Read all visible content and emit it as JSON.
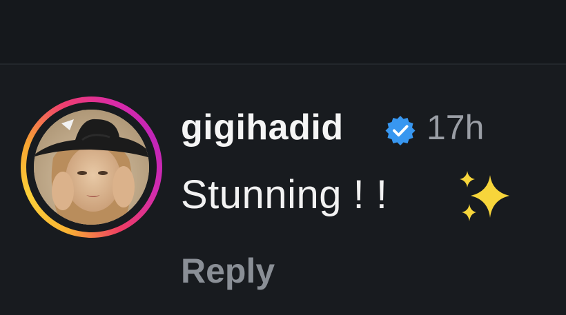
{
  "comment": {
    "username": "gigihadid",
    "verified": true,
    "timestamp": "17h",
    "text": "Stunning ! !",
    "emoji": "sparkles",
    "reply_label": "Reply"
  },
  "colors": {
    "background": "#181b1f",
    "username": "#f5f5f5",
    "timestamp": "#9a9ea5",
    "reply": "#8a8f96",
    "verified_badge": "#3897f0",
    "sparkles": "#f7d53b",
    "story_ring": [
      "#f9b233",
      "#ef3f6f",
      "#c125b8"
    ]
  },
  "icons": {
    "verified": "verified-badge-icon",
    "sparkles": "sparkles-icon"
  }
}
